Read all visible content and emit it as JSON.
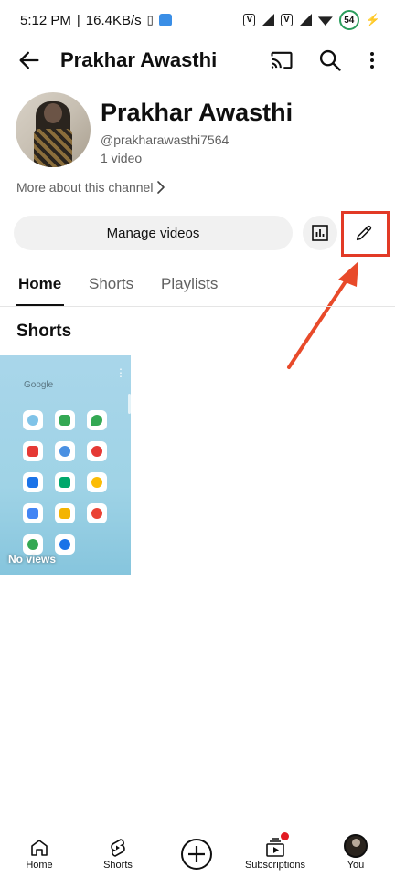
{
  "status_bar": {
    "time": "5:12 PM",
    "speed": "16.4KB/s",
    "battery": "54"
  },
  "app_bar": {
    "title": "Prakhar Awasthi",
    "icons": [
      "back-arrow-icon",
      "cast-icon",
      "search-icon",
      "more-vert-icon"
    ]
  },
  "channel": {
    "name": "Prakhar Awasthi",
    "handle": "@prakharawasthi7564",
    "video_count": "1 video",
    "more_about": "More about this channel"
  },
  "actions": {
    "manage_videos": "Manage videos",
    "icons": [
      "analytics-icon",
      "edit-pencil-icon"
    ]
  },
  "tabs": [
    {
      "label": "Home",
      "active": true
    },
    {
      "label": "Shorts",
      "active": false
    },
    {
      "label": "Playlists",
      "active": false
    }
  ],
  "shorts_section": {
    "title": "Shorts",
    "items": [
      {
        "thumb_text": "Google",
        "views": "No views"
      }
    ]
  },
  "annotation": {
    "highlight_color": "#e23a26"
  },
  "bottom_nav": [
    {
      "label": "Home",
      "icon": "home-icon"
    },
    {
      "label": "Shorts",
      "icon": "shorts-icon"
    },
    {
      "label": "",
      "icon": "create-plus-icon"
    },
    {
      "label": "Subscriptions",
      "icon": "subscriptions-icon"
    },
    {
      "label": "You",
      "icon": "avatar"
    }
  ]
}
